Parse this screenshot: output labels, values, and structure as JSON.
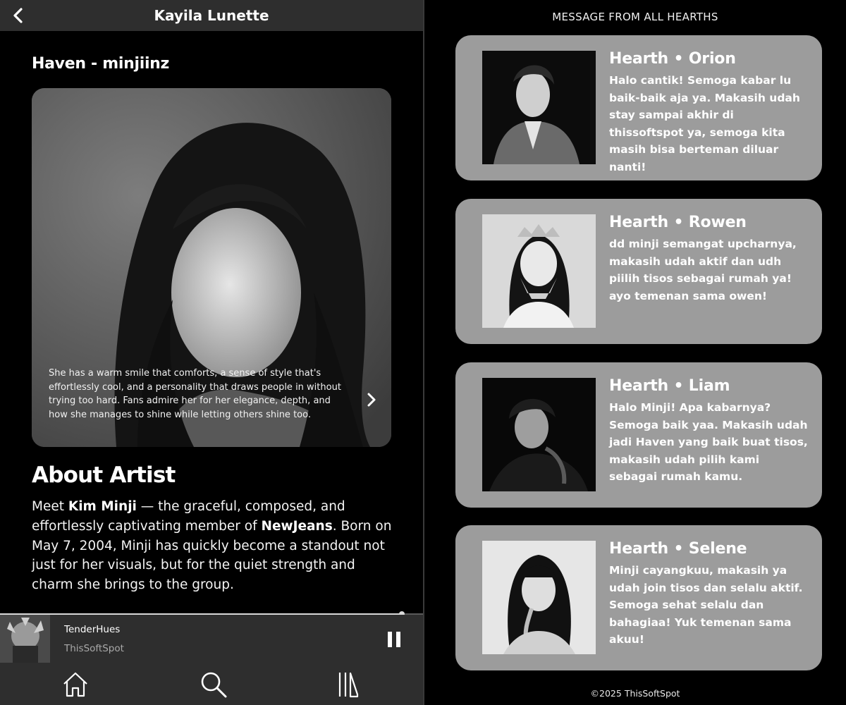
{
  "left": {
    "header": {
      "title": "Kayila Lunette",
      "back_icon": "chevron-left-icon"
    },
    "song_title": "Haven - minjiinz",
    "card": {
      "caption": "She has a warm smile that comforts, a sense of style that's effortlessly cool, and a personality that draws people in without trying too hard. Fans admire her for her elegance, depth, and how she manages to shine while letting others shine too.",
      "next_icon": "chevron-right-icon"
    },
    "about": {
      "title": "About Artist",
      "p1": "Meet ",
      "name": "Kim Minji",
      "p2": " — the graceful, composed, and effortlessly captivating member of ",
      "group": "NewJeans",
      "p3": ". Born on May 7, 2004, Minji has quickly become a standout not just for her visuals, but for the quiet strength and charm she brings to the group."
    },
    "player": {
      "song": "TenderHues",
      "artist": "ThisSoftSpot",
      "progress": 0.95,
      "pause_icon": "pause-icon"
    },
    "nav": {
      "home_icon": "home-icon",
      "search_icon": "search-icon",
      "library_icon": "library-icon"
    }
  },
  "right": {
    "header": "MESSAGE FROM ALL HEARTHS",
    "cards": [
      {
        "name": "Hearth • Orion",
        "text": "Halo cantik! Semoga kabar lu baik-baik aja ya. Makasih udah stay sampai akhir di thissoftspot ya, semoga kita masih bisa berteman diluar nanti!"
      },
      {
        "name": "Hearth • Rowen",
        "text": "dd  minji semangat upcharnya, makasih udah aktif dan udh piilih tisos sebagai rumah ya! ayo temenan sama owen!"
      },
      {
        "name": "Hearth • Liam",
        "text": "Halo Minji! Apa kabarnya? Semoga baik yaa. Makasih udah jadi Haven yang baik buat tisos, makasih udah pilih kami sebagai rumah kamu."
      },
      {
        "name": "Hearth • Selene",
        "text": "Minji cayangkuu, makasih ya udah join tisos dan selalu aktif. Semoga sehat selalu dan bahagiaa! Yuk temenan sama akuu!"
      }
    ],
    "footer": "©2025 ThisSoftSpot"
  }
}
